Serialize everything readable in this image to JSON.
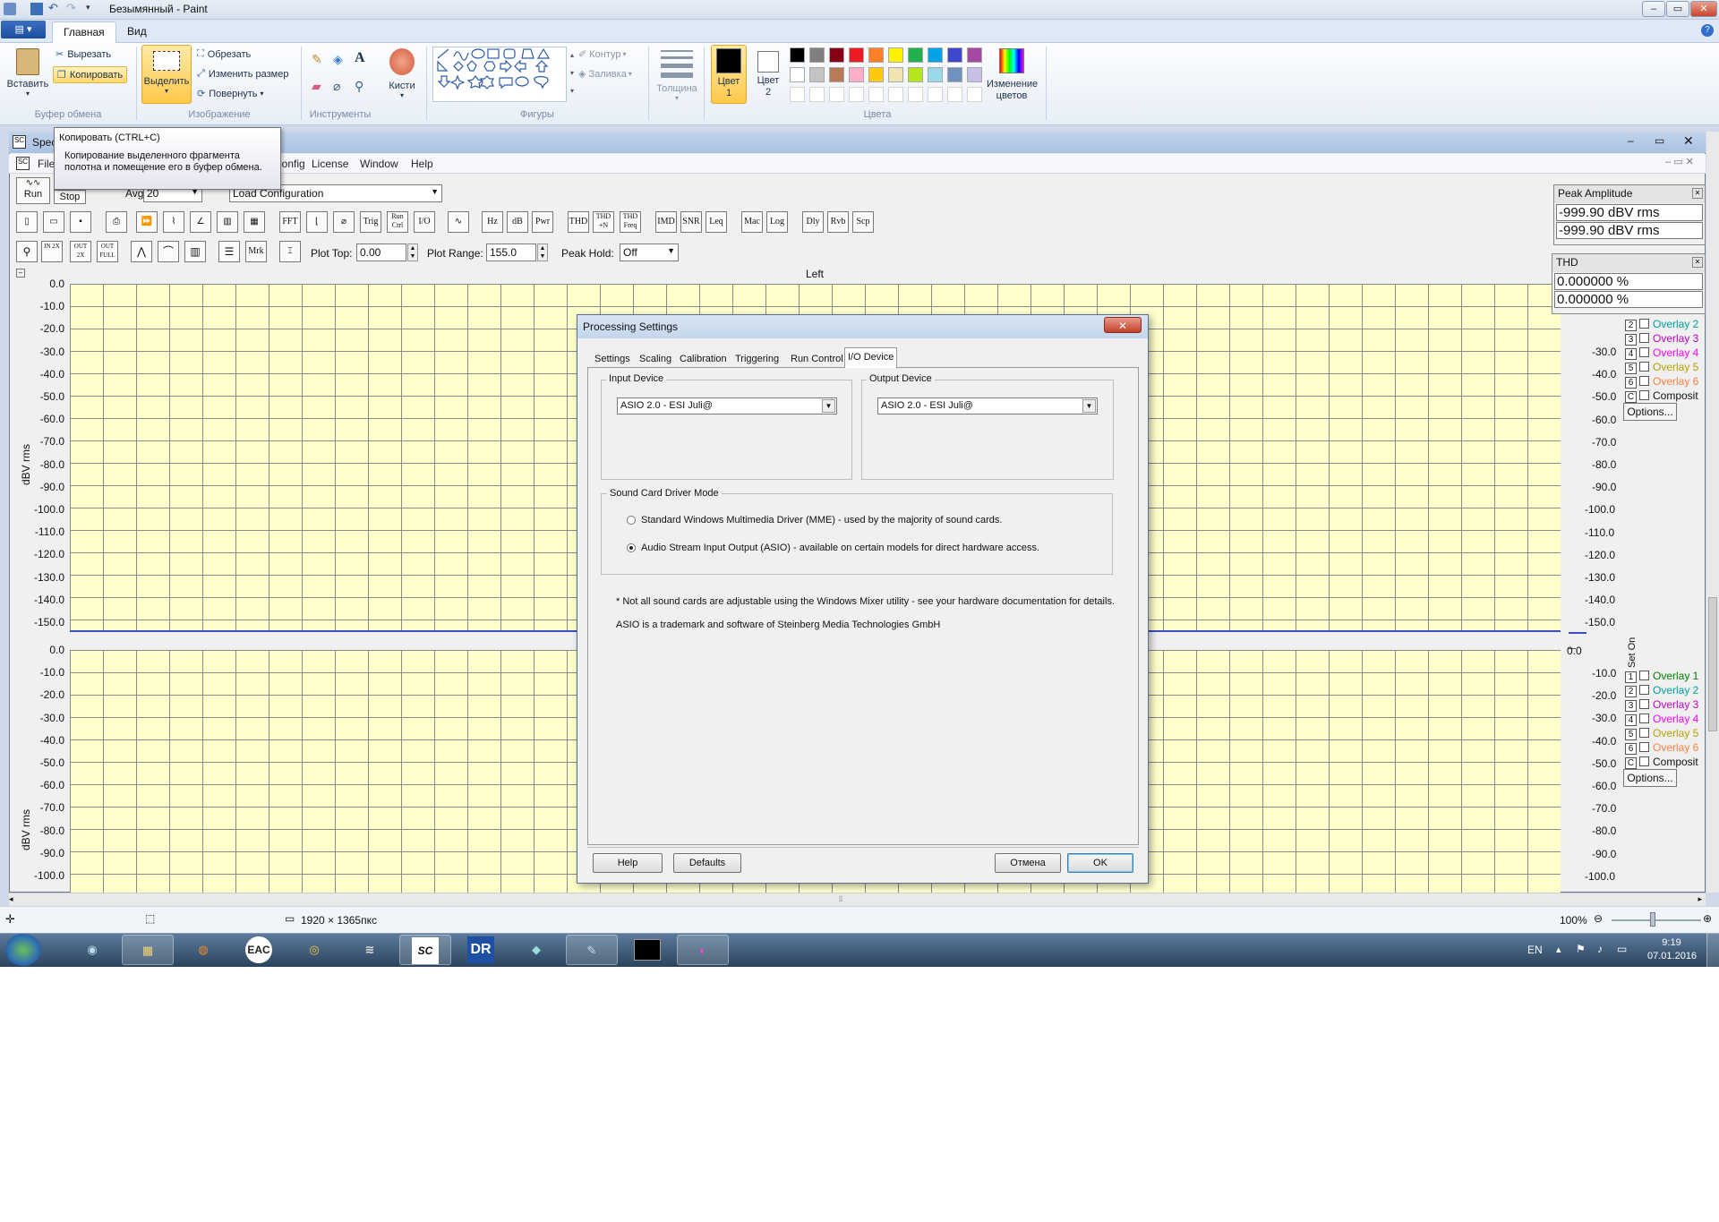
{
  "paint": {
    "title": "Безымянный - Paint",
    "tabs": [
      "Главная",
      "Вид"
    ],
    "clipboard": {
      "paste": "Вставить",
      "cut": "Вырезать",
      "copy": "Копировать",
      "group": "Буфер обмена"
    },
    "image": {
      "select": "Выделить",
      "crop": "Обрезать",
      "resize": "Изменить размер",
      "rotate": "Повернуть",
      "group": "Изображение"
    },
    "tools": {
      "group": "Инструменты",
      "brushes": "Кисти"
    },
    "shapes": {
      "group": "Фигуры",
      "outline": "Контур",
      "fill": "Заливка"
    },
    "size_label": "Толщина",
    "color1": "Цвет 1",
    "color2": "Цвет 2",
    "colors_group": "Цвета",
    "edit_colors": "Изменение цветов",
    "palette_row1": [
      "#000000",
      "#7f7f7f",
      "#880015",
      "#ed1c24",
      "#ff7f27",
      "#fff200",
      "#22b14c",
      "#00a2e8",
      "#3f48cc",
      "#a349a4"
    ],
    "palette_row2": [
      "#ffffff",
      "#c3c3c3",
      "#b97a57",
      "#ffaec9",
      "#ffc90e",
      "#efe4b0",
      "#b5e61d",
      "#99d9ea",
      "#7092be",
      "#c8bfe7"
    ],
    "tooltip": {
      "title": "Копировать (CTRL+C)",
      "body": "Копирование выделенного фрагмента полотна и помещение его в буфер обмена."
    },
    "status": {
      "size": "1920 × 1365пкс",
      "zoom": "100%"
    }
  },
  "spec": {
    "title": "Spec",
    "menu": [
      "File",
      "Config",
      "License",
      "Window",
      "Help"
    ],
    "run": "Run",
    "stop": "Stop",
    "avg_label": "Avg",
    "avg_value": "20",
    "load_config": "Load Configuration",
    "toolbar1": [
      "FFT",
      "Trig",
      "Run Ctrl",
      "I/O",
      "Hz",
      "dB",
      "Pwr",
      "THD",
      "THD +N",
      "THD Freq",
      "IMD",
      "SNR",
      "Leq",
      "Mac",
      "Log",
      "Dly",
      "Rvb",
      "Scp"
    ],
    "toolbar2": [
      "Mrk"
    ],
    "plot_top_label": "Plot Top:",
    "plot_top_value": "0.00",
    "plot_range_label": "Plot Range:",
    "plot_range_value": "155.0",
    "peak_hold_label": "Peak Hold:",
    "peak_hold_value": "Off",
    "channel_label": "Left",
    "y_axis_label": "dBV rms",
    "yticks_top": [
      "0.0",
      "-10.0",
      "-20.0",
      "-30.0",
      "-40.0",
      "-50.0",
      "-60.0",
      "-70.0",
      "-80.0",
      "-90.0",
      "-100.0",
      "-110.0",
      "-120.0",
      "-130.0",
      "-140.0",
      "-150.0"
    ],
    "yticks_bottom": [
      "0.0",
      "-10.0",
      "-20.0",
      "-30.0",
      "-40.0",
      "-50.0",
      "-60.0",
      "-70.0",
      "-80.0",
      "-90.0",
      "-100.0"
    ],
    "yticks_right_top": [
      "-30.0",
      "-40.0",
      "-50.0",
      "-60.0",
      "-70.0",
      "-80.0",
      "-90.0",
      "-100.0",
      "-110.0",
      "-120.0",
      "-130.0",
      "-140.0",
      "-150.0"
    ],
    "overlays_top": [
      {
        "num": "2",
        "name": "Overlay 2",
        "color": "#00a0a0"
      },
      {
        "num": "3",
        "name": "Overlay 3",
        "color": "#c000c0"
      },
      {
        "num": "4",
        "name": "Overlay 4",
        "color": "#ff00ff"
      },
      {
        "num": "5",
        "name": "Overlay 5",
        "color": "#b8a000"
      },
      {
        "num": "6",
        "name": "Overlay 6",
        "color": "#ff8040"
      },
      {
        "num": "C",
        "name": "Composit",
        "color": "#111111"
      }
    ],
    "overlays_bottom": [
      {
        "num": "1",
        "name": "Overlay 1",
        "color": "#008000"
      },
      {
        "num": "2",
        "name": "Overlay 2",
        "color": "#00a0a0"
      },
      {
        "num": "3",
        "name": "Overlay 3",
        "color": "#c000c0"
      },
      {
        "num": "4",
        "name": "Overlay 4",
        "color": "#ff00ff"
      },
      {
        "num": "5",
        "name": "Overlay 5",
        "color": "#b8a000"
      },
      {
        "num": "6",
        "name": "Overlay 6",
        "color": "#ff8040"
      },
      {
        "num": "C",
        "name": "Composit",
        "color": "#111111"
      }
    ],
    "set_on": "Set On",
    "options": "Options...",
    "peak_amp_title": "Peak Amplitude",
    "peak_amp_values": [
      "-999.90 dBV rms",
      "-999.90 dBV rms"
    ],
    "thd_title": "THD",
    "thd_values": [
      "0.000000 %",
      "0.000000 %"
    ]
  },
  "dialog": {
    "title": "Processing Settings",
    "tabs": [
      "Settings",
      "Scaling",
      "Calibration",
      "Triggering",
      "Run Control",
      "I/O Device"
    ],
    "input_device_label": "Input Device",
    "input_device_value": "ASIO 2.0 - ESI Juli@",
    "output_device_label": "Output Device",
    "output_device_value": "ASIO 2.0 - ESI Juli@",
    "driver_mode_label": "Sound Card Driver Mode",
    "mme_option": "Standard Windows Multimedia Driver (MME) - used by the majority of sound cards.",
    "asio_option": "Audio Stream Input Output (ASIO) - available on certain models for direct hardware access.",
    "note1": "* Not all sound cards are adjustable using the Windows Mixer utility - see your hardware documentation for details.",
    "note2": "ASIO is a trademark and software of Steinberg Media Technologies GmbH",
    "help": "Help",
    "defaults": "Defaults",
    "cancel": "Отмена",
    "ok": "OK"
  },
  "taskbar": {
    "apps": [
      "EAC",
      "DR"
    ],
    "lang": "EN",
    "time": "9:19",
    "date": "07.01.2016"
  }
}
